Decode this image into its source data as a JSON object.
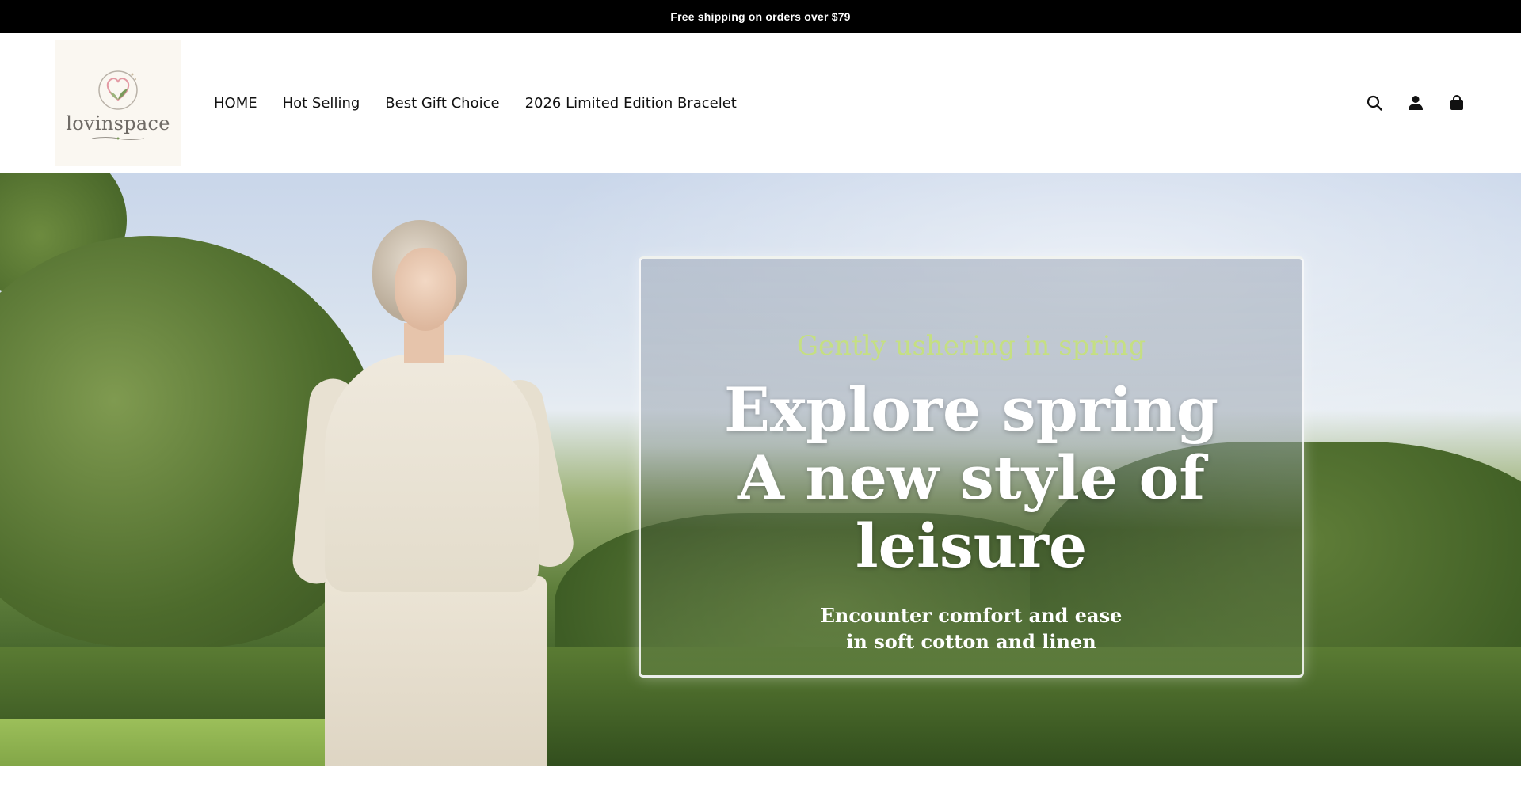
{
  "announcement": {
    "text": "Free shipping on orders over $79"
  },
  "brand": {
    "name": "lovinspace"
  },
  "nav": {
    "items": [
      {
        "label": "HOME"
      },
      {
        "label": "Hot Selling"
      },
      {
        "label": "Best Gift Choice"
      },
      {
        "label": "2026 Limited Edition Bracelet"
      }
    ]
  },
  "header_icons": [
    "search-icon",
    "account-icon",
    "cart-icon"
  ],
  "hero": {
    "eyebrow": "Gently ushering in spring",
    "headline_line1": "Explore spring",
    "headline_line2": "A new style of leisure",
    "sub_line1": "Encounter comfort and ease",
    "sub_line2": "in soft cotton and linen"
  },
  "colors": {
    "announcement_bg": "#000000",
    "eyebrow": "#c6e27a",
    "text_dark": "#111111"
  }
}
